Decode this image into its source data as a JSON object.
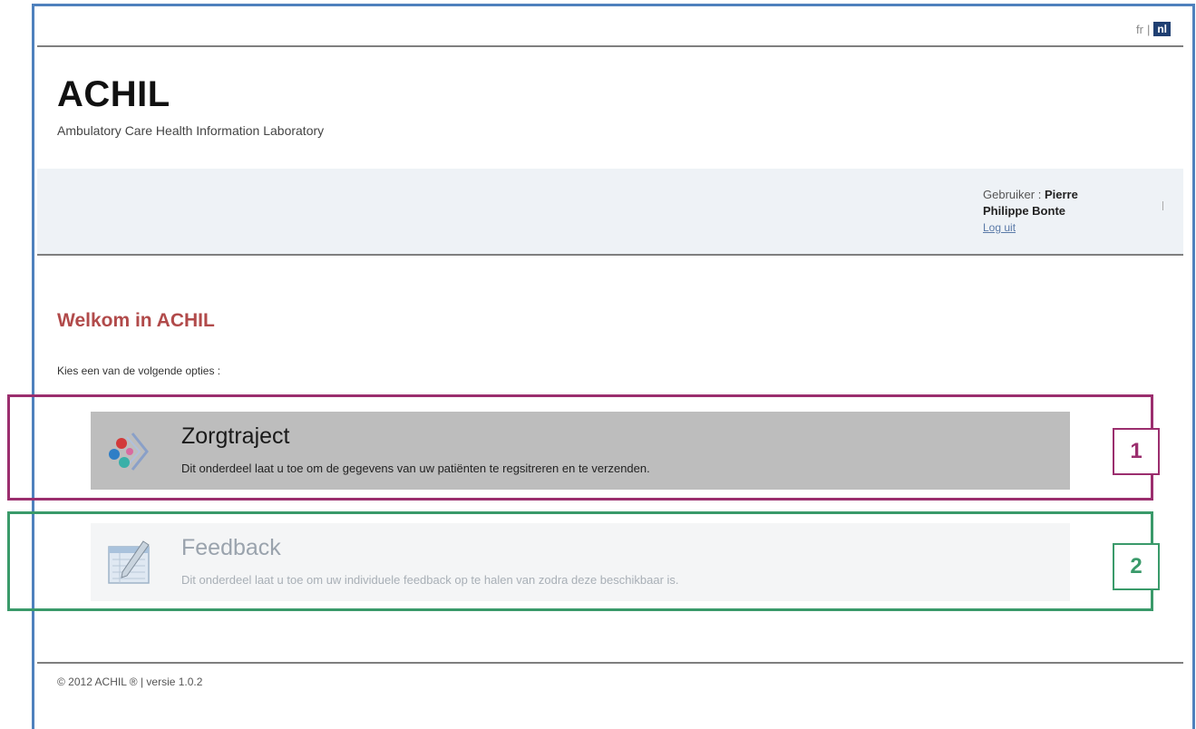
{
  "lang": {
    "fr": "fr",
    "separator": "|",
    "nl": "nl"
  },
  "header": {
    "title": "ACHIL",
    "subtitle": "Ambulatory Care Health Information Laboratory"
  },
  "user": {
    "label": "Gebruiker :",
    "name_first": "Pierre",
    "name_rest": "Philippe Bonte",
    "logout": "Log uit"
  },
  "main": {
    "welcome": "Welkom in ACHIL",
    "choose": "Kies een van de volgende opties :",
    "options": [
      {
        "title": "Zorgtraject",
        "description": "Dit onderdeel laat u toe om de gegevens van uw patiënten te regsitreren en te verzenden.",
        "icon": "care-path-icon"
      },
      {
        "title": "Feedback",
        "description": "Dit onderdeel laat u toe om uw individuele feedback op te halen van zodra deze beschikbaar is.",
        "icon": "feedback-icon"
      }
    ]
  },
  "annotations": {
    "marker1": "1",
    "marker2": "2",
    "color1": "#9b2e6e",
    "color2": "#3a9a6a"
  },
  "footer": {
    "text": "© 2012 ACHIL ® | versie 1.0.2"
  }
}
